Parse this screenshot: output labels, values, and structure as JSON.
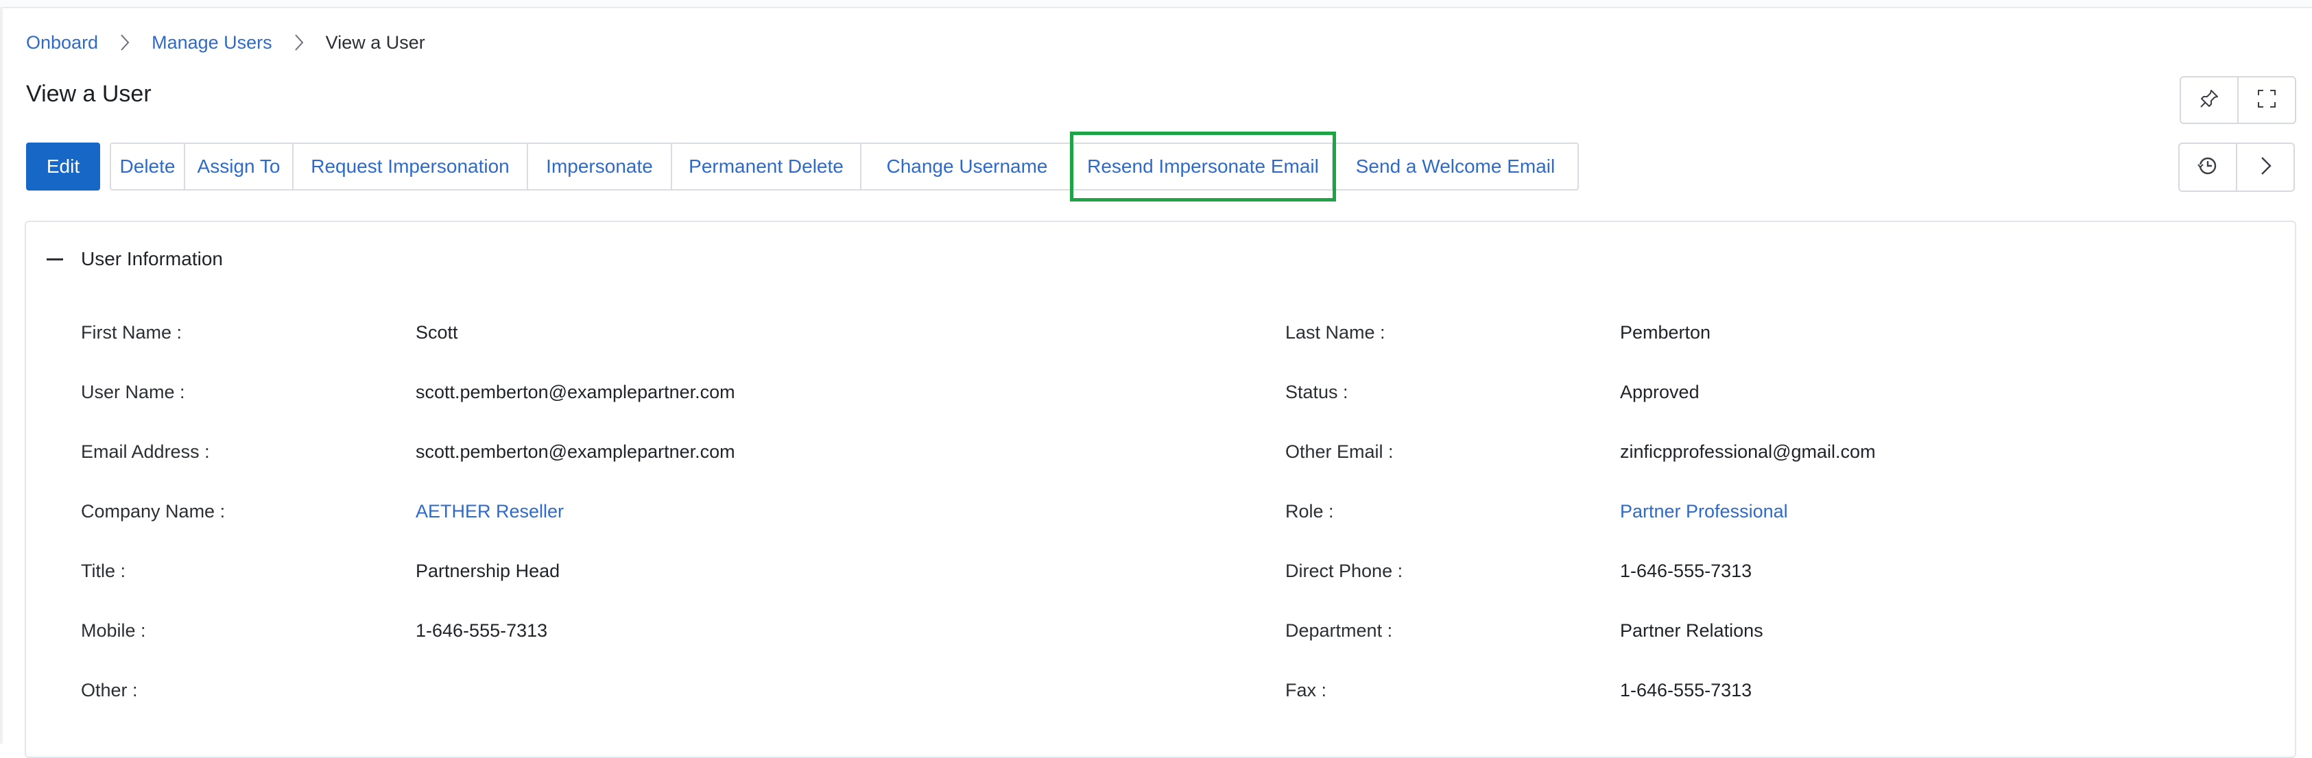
{
  "breadcrumb": {
    "items": [
      {
        "label": "Onboard"
      },
      {
        "label": "Manage Users"
      },
      {
        "label": "View a User"
      }
    ]
  },
  "page": {
    "title": "View a User"
  },
  "toolbar": {
    "edit": "Edit",
    "delete": "Delete",
    "assign_to": "Assign To",
    "request_impersonation": "Request Impersonation",
    "impersonate": "Impersonate",
    "permanent_delete": "Permanent Delete",
    "change_username": "Change Username",
    "resend_impersonate_email": "Resend Impersonate Email",
    "send_welcome_email": "Send a Welcome Email"
  },
  "icons": {
    "pin": "pin-icon",
    "expand": "expand-icon",
    "history": "history-icon",
    "next": "chevron-right-icon"
  },
  "colors": {
    "primary": "#1667c6",
    "link": "#2f6ac8",
    "highlight": "#1fa347"
  },
  "section": {
    "title": "User Information",
    "left": [
      {
        "label": "First Name :",
        "value": "Scott"
      },
      {
        "label": "User Name :",
        "value": "scott.pemberton@examplepartner.com"
      },
      {
        "label": "Email Address :",
        "value": "scott.pemberton@examplepartner.com"
      },
      {
        "label": "Company Name :",
        "value": "AETHER Reseller"
      },
      {
        "label": "Title :",
        "value": "Partnership Head"
      },
      {
        "label": "Mobile :",
        "value": "1-646-555-7313"
      },
      {
        "label": "Other :",
        "value": ""
      }
    ],
    "right": [
      {
        "label": "Last Name :",
        "value": "Pemberton"
      },
      {
        "label": "Status :",
        "value": "Approved"
      },
      {
        "label": "Other Email :",
        "value": "zinficpprofessional@gmail.com"
      },
      {
        "label": "Role :",
        "value": "Partner Professional"
      },
      {
        "label": "Direct Phone :",
        "value": "1-646-555-7313"
      },
      {
        "label": "Department :",
        "value": "Partner Relations"
      },
      {
        "label": "Fax :",
        "value": "1-646-555-7313"
      }
    ]
  }
}
